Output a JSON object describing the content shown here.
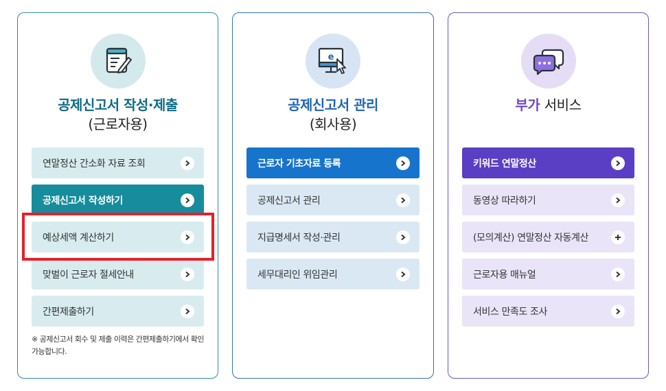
{
  "cards": [
    {
      "icon": "document-pen-icon",
      "title_line1": "공제신고서 작성·제출",
      "title_line2": "(근로자용)",
      "items": [
        {
          "label": "연말정산 간소화 자료 조회",
          "icon": "chevron-right-icon"
        },
        {
          "label": "공제신고서 작성하기",
          "icon": "chevron-right-icon",
          "primary": true
        },
        {
          "label": "예상세액 계산하기",
          "icon": "chevron-right-icon"
        },
        {
          "label": "맞벌이 근로자 절세안내",
          "icon": "chevron-right-icon"
        },
        {
          "label": "간편제출하기",
          "icon": "chevron-right-icon"
        }
      ],
      "note": "※ 공제신고서 회수 및 제출 이력은 간편제출하기에서 확인 가능합니다."
    },
    {
      "icon": "monitor-cursor-icon",
      "title_line1": "공제신고서 관리",
      "title_line2": "(회사용)",
      "items": [
        {
          "label": "근로자 기초자료 등록",
          "icon": "chevron-right-icon",
          "primary": true
        },
        {
          "label": "공제신고서 관리",
          "icon": "chevron-right-icon"
        },
        {
          "label": "지급명세서 작성·관리",
          "icon": "chevron-right-icon"
        },
        {
          "label": "세무대리인 위임관리",
          "icon": "chevron-right-icon"
        }
      ]
    },
    {
      "icon": "chat-bubbles-icon",
      "title_accent": "부가",
      "title_rest": "서비스",
      "items": [
        {
          "label": "키워드 연말정산",
          "icon": "chevron-right-icon",
          "primary": true
        },
        {
          "label": "동영상 따라하기",
          "icon": "chevron-right-icon"
        },
        {
          "label": "(모의계산) 연말정산 자동계산",
          "icon": "plus-icon"
        },
        {
          "label": "근로자용 매뉴얼",
          "icon": "chevron-right-icon"
        },
        {
          "label": "서비스 만족도 조사",
          "icon": "chevron-right-icon"
        }
      ]
    }
  ],
  "colors": {
    "card1_accent": "#168c9c",
    "card2_accent": "#1774cc",
    "card3_accent": "#5a3ec4",
    "highlight": "#e5202a"
  }
}
